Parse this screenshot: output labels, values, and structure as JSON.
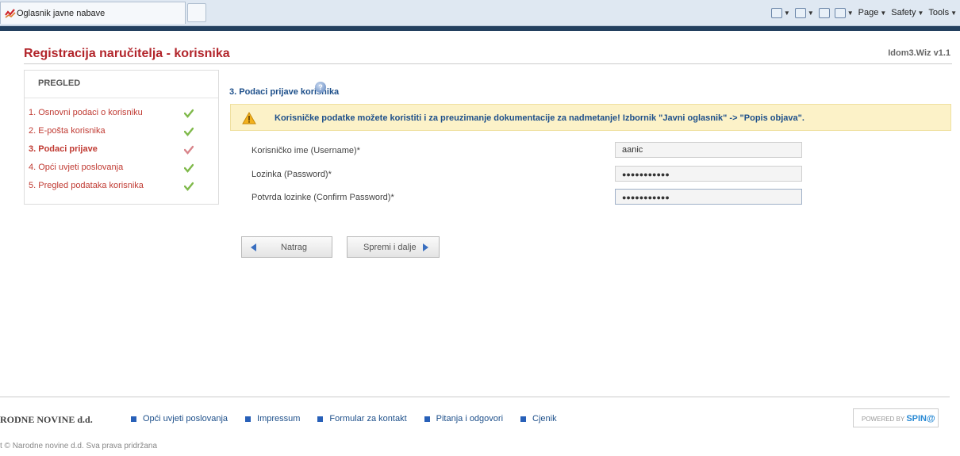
{
  "browser": {
    "tab_title": "Oglasnik javne nabave",
    "commands": [
      "Page",
      "Safety",
      "Tools"
    ]
  },
  "header": {
    "title": "Registracija naručitelja - korisnika",
    "version": "Idom3.Wiz v1.1"
  },
  "sidebar": {
    "title": "PREGLED",
    "items": [
      {
        "label": "1. Osnovni podaci o korisniku",
        "state": "done"
      },
      {
        "label": "2. E-pošta korisnika",
        "state": "done"
      },
      {
        "label": "3. Podaci prijave",
        "state": "active"
      },
      {
        "label": "4. Opći uvjeti poslovanja",
        "state": "done"
      },
      {
        "label": "5. Pregled podataka korisnika",
        "state": "done"
      }
    ]
  },
  "main": {
    "section_title": "3. Podaci prijave korisnika",
    "notice": "Korisničke podatke možete koristiti i za preuzimanje dokumentacije za nadmetanje! Izbornik \"Javni oglasnik\" -> \"Popis objava\".",
    "fields": [
      {
        "label": "Korisničko ime (Username)*",
        "value": "aanic"
      },
      {
        "label": "Lozinka (Password)*",
        "value": "●●●●●●●●●●●"
      },
      {
        "label": "Potvrda lozinke (Confirm Password)*",
        "value": "●●●●●●●●●●●"
      }
    ],
    "back_label": "Natrag",
    "next_label": "Spremi i dalje"
  },
  "footer": {
    "brand": "RODNE NOVINE d.d.",
    "links": [
      "Opći uvjeti poslovanja",
      "Impressum",
      "Formular za kontakt",
      "Pitanja i odgovori",
      "Cjenik"
    ],
    "powered_prefix": "POWERED BY",
    "powered_brand": "SPIN@",
    "copyright": "t © Narodne novine d.d. Sva prava pridržana"
  },
  "colors": {
    "title_red": "#b2252b",
    "link_blue": "#1d4f8a",
    "notice_bg": "#fcf2c8",
    "accent_bar": "#23405f",
    "check_green": "#7fb94a",
    "check_active": "#d8848a"
  }
}
